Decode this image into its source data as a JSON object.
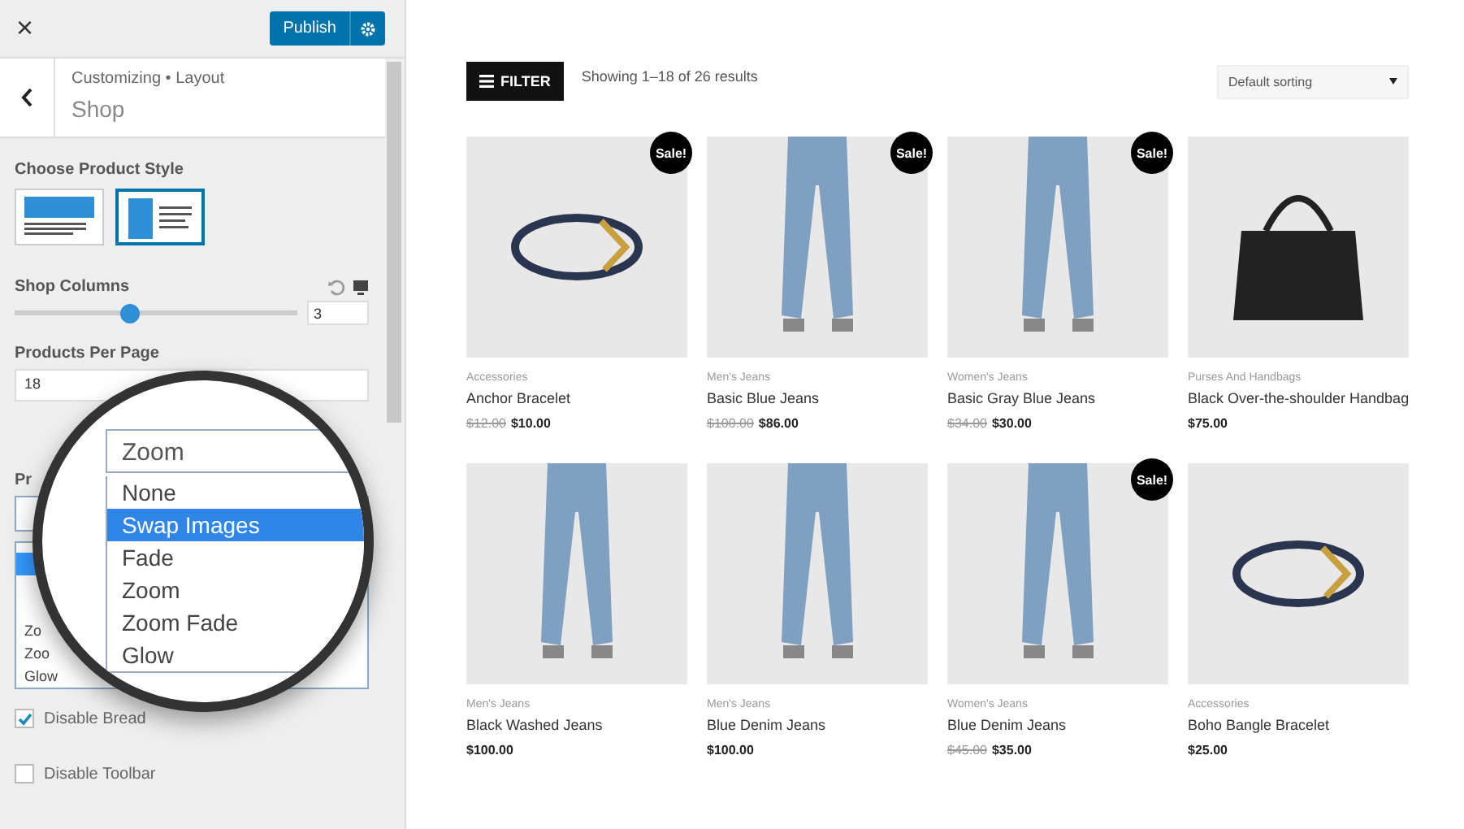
{
  "sidebar": {
    "close": "×",
    "publish": "Publish",
    "breadcrumb": {
      "parent": "Customizing",
      "separator": "•",
      "section": "Layout"
    },
    "title": "Shop",
    "product_style": {
      "label": "Choose Product Style",
      "options": [
        {
          "kind": "wide",
          "selected": false
        },
        {
          "kind": "side",
          "selected": true
        }
      ]
    },
    "shop_columns": {
      "label": "Shop Columns",
      "level": 0.41,
      "value": "3"
    },
    "products_per_page": {
      "label": "Products Per Page",
      "value": "18"
    },
    "hover_label": "Pr",
    "hover_list": [
      {
        "label": "Zo",
        "selected": false
      },
      {
        "label": "Zoo",
        "selected": false
      },
      {
        "label": "Glow",
        "selected": false
      }
    ],
    "checkboxes": [
      {
        "label": "Disable Bread",
        "checked": true
      },
      {
        "label": "Disable Toolbar",
        "checked": false
      }
    ]
  },
  "magnifier": {
    "value": "Zoom",
    "options": [
      {
        "label": "None",
        "highlighted": false
      },
      {
        "label": "Swap Images",
        "highlighted": true
      },
      {
        "label": "Fade",
        "highlighted": false
      },
      {
        "label": "Zoom",
        "highlighted": false
      },
      {
        "label": "Zoom Fade",
        "highlighted": false
      },
      {
        "label": "Glow",
        "highlighted": false
      }
    ]
  },
  "shop": {
    "filter": "FILTER",
    "result_count": "Showing 1–18 of 26 results",
    "sorting": "Default sorting",
    "products": [
      {
        "category": "Accessories",
        "name": "Anchor Bracelet",
        "old_price": "$12.00",
        "price": "$10.00",
        "sale": "Sale!",
        "kind": "bracelet"
      },
      {
        "category": "Men's Jeans",
        "name": "Basic Blue Jeans",
        "old_price": "$100.00",
        "price": "$86.00",
        "sale": "Sale!",
        "kind": "jeans"
      },
      {
        "category": "Women's Jeans",
        "name": "Basic Gray Blue Jeans",
        "old_price": "$34.00",
        "price": "$30.00",
        "sale": "Sale!",
        "kind": "jeans"
      },
      {
        "category": "Purses And Handbags",
        "name": "Black Over-the-shoulder Handbag",
        "price": "$75.00",
        "kind": "bag"
      },
      {
        "category": "Men's Jeans",
        "name": "Black Washed Jeans",
        "price": "$100.00",
        "kind": "jeans"
      },
      {
        "category": "Men's Jeans",
        "name": "Blue Denim Jeans",
        "price": "$100.00",
        "kind": "jeans"
      },
      {
        "category": "Women's Jeans",
        "name": "Blue Denim Jeans",
        "old_price": "$45.00",
        "price": "$35.00",
        "sale": "Sale!",
        "kind": "jeans"
      },
      {
        "category": "Accessories",
        "name": "Boho Bangle Bracelet",
        "price": "$25.00",
        "kind": "bracelet"
      }
    ]
  }
}
